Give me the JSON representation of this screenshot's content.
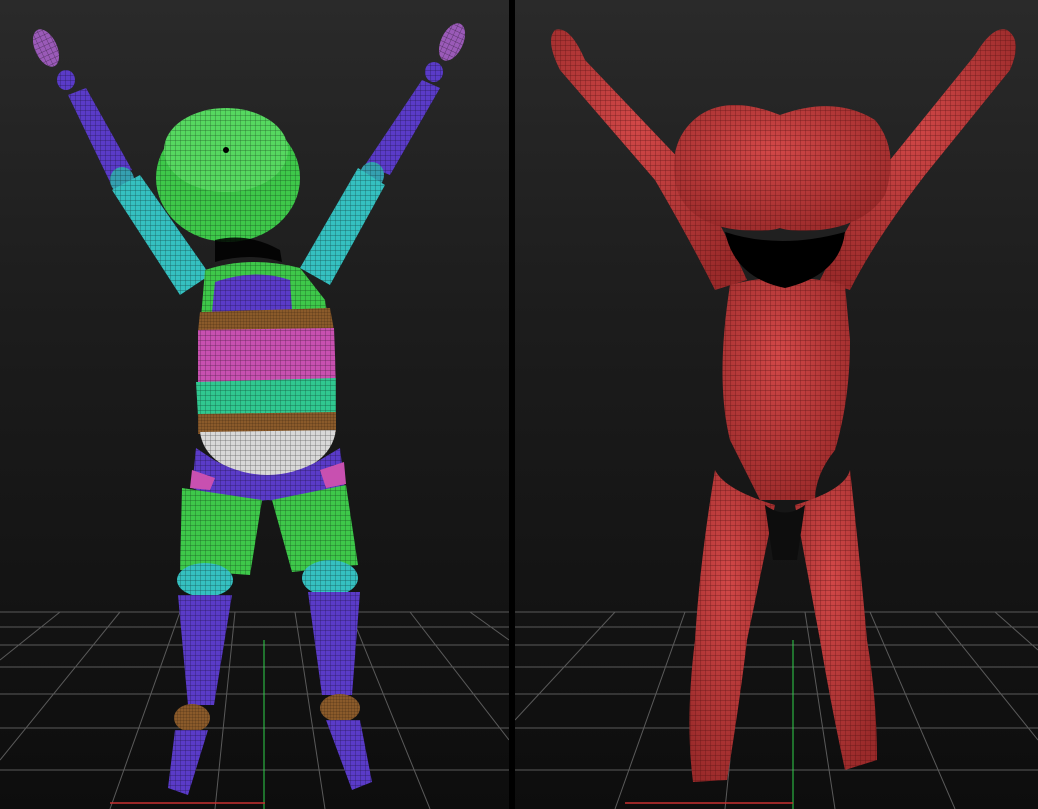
{
  "viewports": [
    {
      "id": "left",
      "model": "polygroup-colored-mannequin",
      "display": "polyframe-polygroups"
    },
    {
      "id": "right",
      "model": "red-unified-sculpt",
      "display": "polyframe"
    }
  ],
  "colors": {
    "background_top": "#2a2a2a",
    "background_bottom": "#0d0d0d",
    "grid_line": "#5a5a5a",
    "axis_green": "#2fd24a",
    "axis_red": "#c83030",
    "group_purple": "#5a3bc8",
    "group_cyan": "#35c0c0",
    "group_green": "#3ec84a",
    "group_magenta": "#c850b0",
    "group_teal": "#30c890",
    "group_brown": "#8a5a2a",
    "group_white": "#d8d8d8",
    "group_lavender": "#9a5ab8",
    "sculpt_red": "#c23c3c"
  }
}
